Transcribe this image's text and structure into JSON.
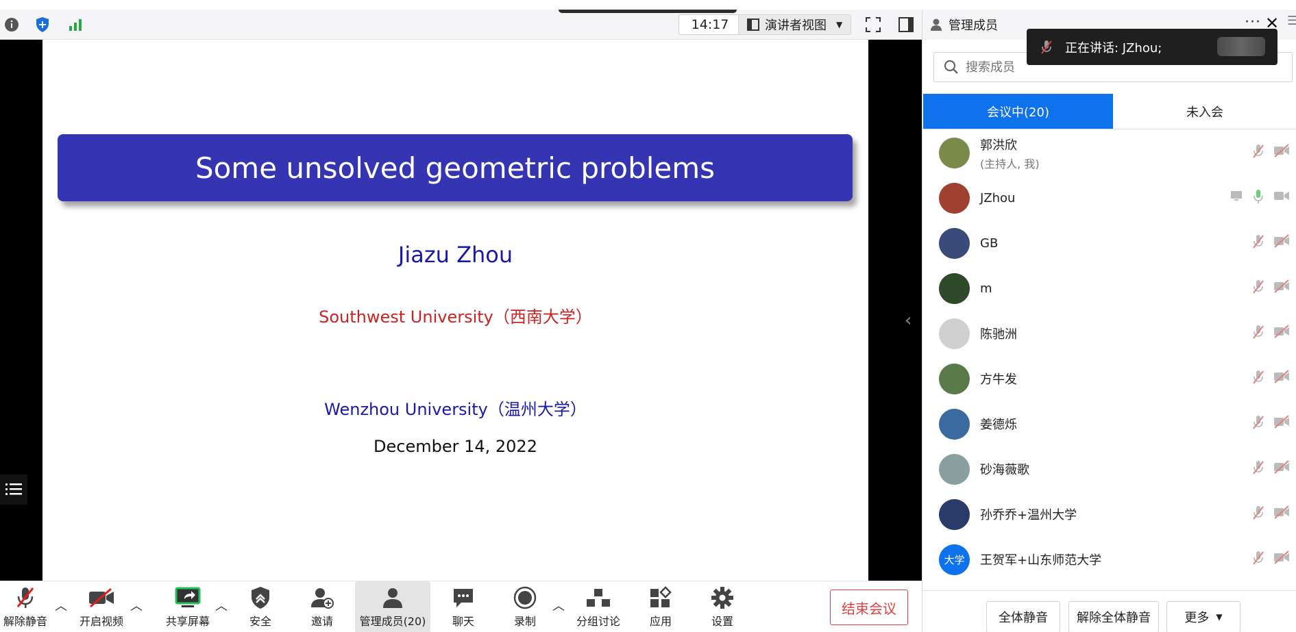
{
  "topbar": {
    "time": "14:17",
    "view_label": "演讲者视图"
  },
  "slide": {
    "title": "Some unsolved geometric problems",
    "author": "Jiazu Zhou",
    "affiliation_1": "Southwest University（西南大学）",
    "affiliation_2": "Wenzhou University（温州大学）",
    "date": "December 14, 2022"
  },
  "toolbar": {
    "unmute": "解除静音",
    "start_video": "开启视频",
    "share_screen": "共享屏幕",
    "security": "安全",
    "invite": "邀请",
    "manage_members": "管理成员(20)",
    "chat": "聊天",
    "record": "录制",
    "breakout": "分组讨论",
    "apps": "应用",
    "settings": "设置",
    "end_meeting": "结束会议"
  },
  "panel": {
    "title": "管理成员",
    "search_placeholder": "搜索成员",
    "tab_in_meeting": "会议中(20)",
    "tab_not_joined": "未入会",
    "members": [
      {
        "name": "郭洪欣",
        "sub": "(主持人, 我)",
        "color": "#7a8a4a"
      },
      {
        "name": "JZhou",
        "sub": "",
        "color": "#a04030"
      },
      {
        "name": "GB",
        "sub": "",
        "color": "#3a4a7a"
      },
      {
        "name": "m",
        "sub": "",
        "color": "#2f4a2a"
      },
      {
        "name": "陈驰洲",
        "sub": "",
        "color": "#d0d0d0"
      },
      {
        "name": "方牛发",
        "sub": "",
        "color": "#5a7a4a"
      },
      {
        "name": "姜德烁",
        "sub": "",
        "color": "#3a6aa0"
      },
      {
        "name": "砂海薇歌",
        "sub": "",
        "color": "#8aa0a0"
      },
      {
        "name": "孙乔乔+温州大学",
        "sub": "",
        "color": "#2a3a6a"
      },
      {
        "name": "王贺军+山东师范大学",
        "sub": "",
        "color": "#0e72ed",
        "initials": "大学"
      }
    ],
    "mute_all": "全体静音",
    "unmute_all": "解除全体静音",
    "more": "更多"
  },
  "toast": {
    "text": "正在讲话: JZhou;"
  }
}
